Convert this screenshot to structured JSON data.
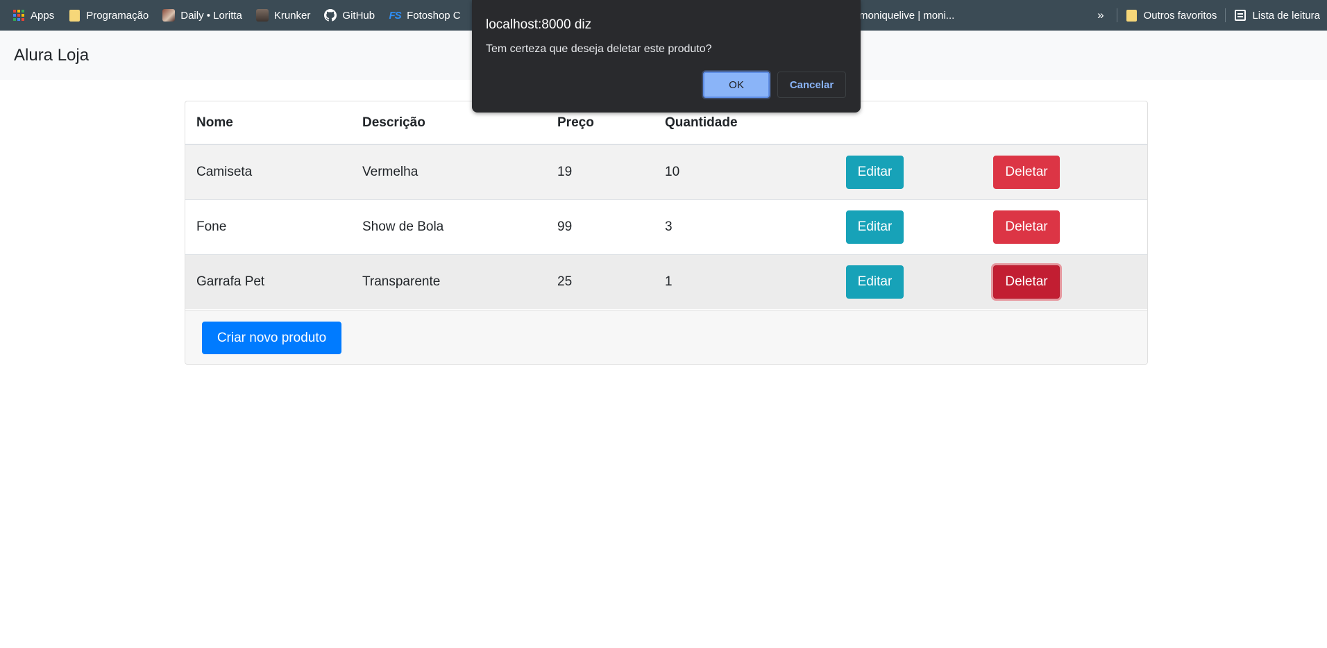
{
  "bookmarks": {
    "items": [
      {
        "label": "Apps",
        "icon": "apps-grid-icon"
      },
      {
        "label": "Programação",
        "icon": "folder-icon"
      },
      {
        "label": "Daily • Loritta",
        "icon": "loritta-favicon-icon"
      },
      {
        "label": "Krunker",
        "icon": "krunker-favicon-icon"
      },
      {
        "label": "GitHub",
        "icon": "github-icon"
      },
      {
        "label": "Fotoshop C",
        "icon": "fotoshop-favicon-icon"
      }
    ],
    "hidden_item_label": "moniquelive | moni...",
    "overflow_label": "»",
    "other_favorites_label": "Outros favoritos",
    "reading_list_label": "Lista de leitura"
  },
  "navbar": {
    "brand": "Alura Loja"
  },
  "table": {
    "headers": [
      "Nome",
      "Descrição",
      "Preço",
      "Quantidade"
    ],
    "rows": [
      {
        "nome": "Camiseta",
        "descricao": "Vermelha",
        "preco": "19",
        "quantidade": "10"
      },
      {
        "nome": "Fone",
        "descricao": "Show de Bola",
        "preco": "99",
        "quantidade": "3"
      },
      {
        "nome": "Garrafa Pet",
        "descricao": "Transparente",
        "preco": "25",
        "quantidade": "1"
      }
    ],
    "edit_label": "Editar",
    "delete_label": "Deletar"
  },
  "footer": {
    "new_product_label": "Criar novo produto"
  },
  "dialog": {
    "title": "localhost:8000 diz",
    "message": "Tem certeza que deseja deletar este produto?",
    "ok_label": "OK",
    "cancel_label": "Cancelar"
  },
  "colors": {
    "bookmarks_bar": "#3b4b55",
    "edit_button": "#17a2b8",
    "delete_button": "#dc3545",
    "primary_button": "#007bff",
    "dialog_bg": "#292a2d",
    "dialog_accent": "#8ab4f8"
  }
}
